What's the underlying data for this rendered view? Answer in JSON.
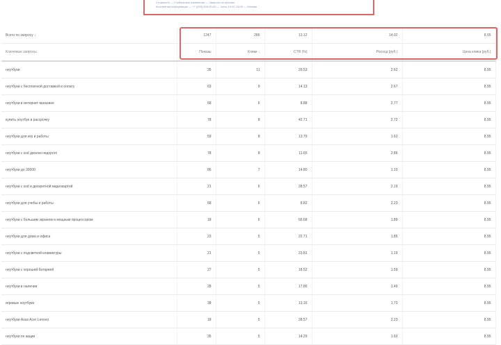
{
  "top_note": {
    "line1": "Стоимость — Глобальные изменения — Запросы по прочим",
    "line2": "Контактная информация — +7 (495) 000-00-00 — Часы 10:00-19:00 — Москва"
  },
  "summary": {
    "label": "Всего по запросу ↓",
    "values": [
      "1247",
      "286",
      "13.12",
      "14.02",
      "8.95"
    ]
  },
  "header": {
    "name": "Ключевые запросы",
    "columns": [
      "Показы",
      "Клики ↓",
      "CTR (%)",
      "Расход (руб.)",
      "Цена клика (руб.)"
    ]
  },
  "rows": [
    {
      "name": "ноутбуки",
      "values": [
        "35",
        "11",
        "29.53",
        "2.62",
        "8.95"
      ]
    },
    {
      "name": "ноутбуки с бесплатной доставкой в оплату",
      "values": [
        "63",
        "9",
        "14.13",
        "2.67",
        "8.95"
      ]
    },
    {
      "name": "ноутбуки в интернет-магазине",
      "values": [
        "68",
        "6",
        "8.88",
        "2.77",
        "8.95"
      ]
    },
    {
      "name": "купить ноутбук в рассрочку",
      "values": [
        "78",
        "8",
        "42.71",
        "2.72",
        "8.95"
      ]
    },
    {
      "name": "ноутбуки для игр и работы",
      "values": [
        "59",
        "8",
        "13.79",
        "1.63",
        "8.95"
      ]
    },
    {
      "name": "ноутбуки с ssd диском недорого",
      "values": [
        "78",
        "8",
        "11.65",
        "2.86",
        "8.95"
      ]
    },
    {
      "name": "ноутбуки до 30000",
      "values": [
        "86",
        "7",
        "14.80",
        "1.10",
        "8.95"
      ]
    },
    {
      "name": "ноутбуки с ssd и дискретной видеокартой",
      "values": [
        "21",
        "6",
        "28.57",
        "2.19",
        "8.95"
      ]
    },
    {
      "name": "ноутбуки для учебы и работы",
      "values": [
        "68",
        "6",
        "8.82",
        "2.23",
        "8.95"
      ]
    },
    {
      "name": "ноутбуки с большим экраном и мощным процессором",
      "values": [
        "18",
        "6",
        "66.68",
        "1.89",
        "8.95"
      ]
    },
    {
      "name": "ноутбуки для дома и офиса",
      "values": [
        "23",
        "5",
        "22.71",
        "1.85",
        "8.95"
      ]
    },
    {
      "name": "ноутбуки с подсветкой клавиатуры",
      "values": [
        "21",
        "5",
        "23.81",
        "1.19",
        "8.95"
      ]
    },
    {
      "name": "ноутбуки с хорошей батареей",
      "values": [
        "27",
        "5",
        "18.52",
        "1.59",
        "8.95"
      ]
    },
    {
      "name": "ноутбуки в наличии",
      "values": [
        "28",
        "5",
        "17.86",
        "1.49",
        "8.95"
      ]
    },
    {
      "name": "игровые ноутбуки",
      "values": [
        "38",
        "5",
        "13.16",
        "1.73",
        "8.95"
      ]
    },
    {
      "name": "ноутбуки Asus Acer Lenovo",
      "values": [
        "18",
        "5",
        "28.57",
        "2.23",
        "8.95"
      ]
    },
    {
      "name": "ноутбуки по акции",
      "values": [
        "35",
        "5",
        "14.29",
        "1.60",
        "8.95"
      ]
    }
  ]
}
